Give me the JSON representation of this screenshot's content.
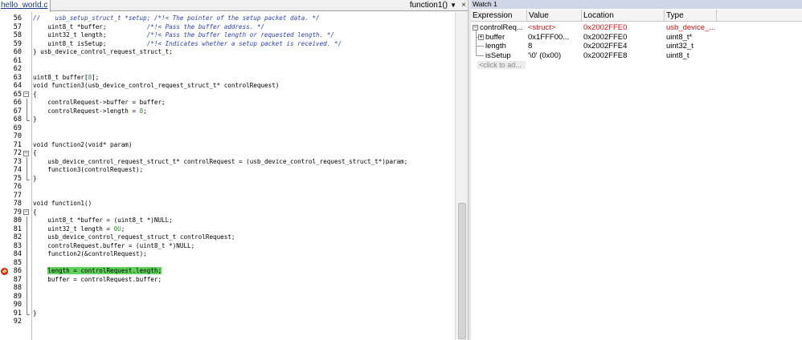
{
  "editor": {
    "file_tab": "hello_world.c",
    "function_selector": "function1()",
    "close_glyph": "×",
    "dropdown_glyph": "▼",
    "lines": [
      {
        "n": "56",
        "t": [
          {
            "c": "cm",
            "s": "//    usb_setup_struct_t *setup; /*!< The pointer of the setup packet data. */"
          }
        ]
      },
      {
        "n": "57",
        "t": [
          {
            "c": "",
            "s": "    uint8_t *buffer;           "
          },
          {
            "c": "cm",
            "s": "/*!< Pass the buffer address. */"
          }
        ]
      },
      {
        "n": "58",
        "t": [
          {
            "c": "",
            "s": "    uint32_t length;           "
          },
          {
            "c": "cm",
            "s": "/*!< Pass the buffer length or requested length. */"
          }
        ]
      },
      {
        "n": "59",
        "t": [
          {
            "c": "",
            "s": "    uint8_t isSetup;           "
          },
          {
            "c": "cm",
            "s": "/*!< Indicates whether a setup packet is received. */"
          }
        ]
      },
      {
        "n": "60",
        "t": [
          {
            "c": "",
            "s": "} usb_device_control_request_struct_t;"
          }
        ]
      },
      {
        "n": "61",
        "t": []
      },
      {
        "n": "62",
        "t": []
      },
      {
        "n": "63",
        "t": [
          {
            "c": "",
            "s": "uint8_t buffer["
          },
          {
            "c": "num",
            "s": "8"
          },
          {
            "c": "",
            "s": "];"
          }
        ]
      },
      {
        "n": "64",
        "t": [
          {
            "c": "",
            "s": "void function3(usb_device_control_request_struct_t* controlRequest)"
          }
        ]
      },
      {
        "n": "65",
        "t": [
          {
            "c": "",
            "s": "{"
          }
        ]
      },
      {
        "n": "66",
        "t": [
          {
            "c": "",
            "s": "    controlRequest->buffer = buffer;"
          }
        ]
      },
      {
        "n": "67",
        "t": [
          {
            "c": "",
            "s": "    controlRequest->length = "
          },
          {
            "c": "num",
            "s": "8"
          },
          {
            "c": "",
            "s": ";"
          }
        ]
      },
      {
        "n": "68",
        "t": [
          {
            "c": "",
            "s": "}"
          }
        ]
      },
      {
        "n": "69",
        "t": []
      },
      {
        "n": "70",
        "t": []
      },
      {
        "n": "71",
        "t": [
          {
            "c": "",
            "s": "void function2(void* param)"
          }
        ]
      },
      {
        "n": "72",
        "t": [
          {
            "c": "",
            "s": "{"
          }
        ]
      },
      {
        "n": "73",
        "t": [
          {
            "c": "",
            "s": "    usb_device_control_request_struct_t* controlRequest = (usb_device_control_request_struct_t*)param;"
          }
        ]
      },
      {
        "n": "74",
        "t": [
          {
            "c": "",
            "s": "    function3(controlRequest);"
          }
        ]
      },
      {
        "n": "75",
        "t": [
          {
            "c": "",
            "s": "}"
          }
        ]
      },
      {
        "n": "76",
        "t": []
      },
      {
        "n": "77",
        "t": []
      },
      {
        "n": "78",
        "t": [
          {
            "c": "",
            "s": "void function1()"
          }
        ]
      },
      {
        "n": "79",
        "t": [
          {
            "c": "",
            "s": "{"
          }
        ]
      },
      {
        "n": "80",
        "t": [
          {
            "c": "",
            "s": "    uint8_t *buffer = (uint8_t *)NULL;"
          }
        ]
      },
      {
        "n": "81",
        "t": [
          {
            "c": "",
            "s": "    uint32_t length = "
          },
          {
            "c": "num",
            "s": "0U"
          },
          {
            "c": "",
            "s": ";"
          }
        ]
      },
      {
        "n": "82",
        "t": [
          {
            "c": "",
            "s": "    usb_device_control_request_struct_t controlRequest;"
          }
        ]
      },
      {
        "n": "83",
        "t": [
          {
            "c": "",
            "s": "    controlRequest.buffer = (uint8_t *)NULL;"
          }
        ]
      },
      {
        "n": "84",
        "t": [
          {
            "c": "",
            "s": "    function2(&controlRequest);"
          }
        ]
      },
      {
        "n": "85",
        "t": []
      },
      {
        "n": "86",
        "t": [
          {
            "c": "",
            "s": "    "
          },
          {
            "c": "hl",
            "s": "length = controlRequest.length;"
          }
        ]
      },
      {
        "n": "87",
        "t": [
          {
            "c": "",
            "s": "    buffer = controlRequest.buffer;"
          }
        ]
      },
      {
        "n": "88",
        "t": []
      },
      {
        "n": "89",
        "t": []
      },
      {
        "n": "90",
        "t": []
      },
      {
        "n": "91",
        "t": [
          {
            "c": "",
            "s": "}"
          }
        ]
      },
      {
        "n": "92",
        "t": []
      }
    ],
    "current_line": "86",
    "highlight_color": "#5fd35a"
  },
  "watch": {
    "title": "Watch 1",
    "columns": {
      "expression": "Expression",
      "value": "Value",
      "location": "Location",
      "type": "Type"
    },
    "rows": [
      {
        "expression": "controlReq...",
        "value": "<struct>",
        "location": "0x2002FFE0",
        "type": "usb_device_...",
        "expanded": true,
        "changed": true
      },
      {
        "expression": "buffer",
        "value": "0x1FFF00...",
        "location": "0x2002FFE0",
        "type": "uint8_t*",
        "expandable": true
      },
      {
        "expression": "length",
        "value": "8",
        "location": "0x2002FFE4",
        "type": "uint32_t"
      },
      {
        "expression": "isSetup",
        "value": "'\\0' (0x00)",
        "location": "0x2002FFE8",
        "type": "uint8_t"
      }
    ],
    "add_placeholder": "<click to ad...",
    "changed_color": "#d01010"
  }
}
